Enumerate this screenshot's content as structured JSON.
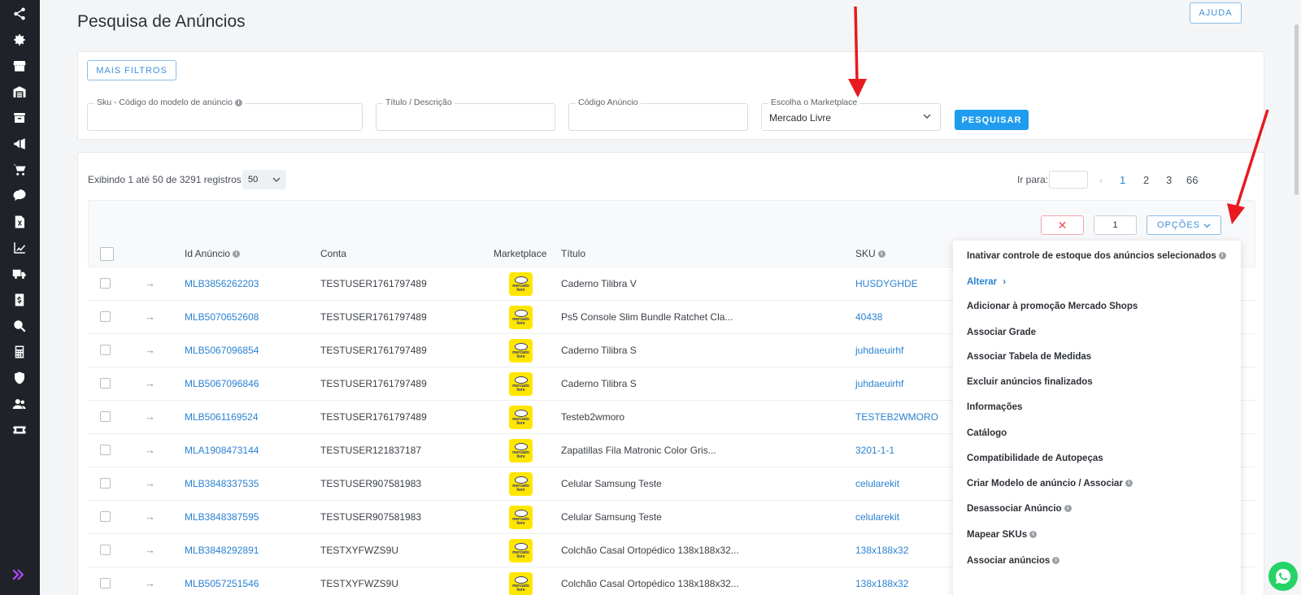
{
  "sidebar": {
    "icons": [
      "share-icon",
      "gear-icon",
      "store-icon",
      "warehouse-icon",
      "archive-icon",
      "megaphone-icon",
      "cart-icon",
      "chat-icon",
      "excel-icon",
      "chart-line-icon",
      "truck-icon",
      "invoice-icon",
      "search-dollar-icon",
      "calculator-icon",
      "shield-icon",
      "users-icon",
      "ticket-icon"
    ],
    "expand_icon": "double-chevron-right-icon"
  },
  "header": {
    "breadcrumb": "",
    "title": "Pesquisa de Anúncios",
    "help_label": "AJUDA"
  },
  "filters": {
    "more_filters_label": "MAIS FILTROS",
    "sku_label": "Sku - Código do modelo de anúncio",
    "sku_value": "",
    "title_label": "Título / Descrição",
    "title_value": "",
    "code_label": "Código Anúncio",
    "code_value": "",
    "marketplace_label": "Escolha o Marketplace",
    "marketplace_value": "Mercado Livre",
    "search_label": "PESQUISAR"
  },
  "results": {
    "showing_text": "Exibindo 1 até 50 de 3291 registros",
    "per_page": "50",
    "goto_label": "Ir para:",
    "goto_value": "",
    "pages": [
      "1",
      "2",
      "3",
      "66"
    ],
    "active_page": "1",
    "clear_icon": "close-icon",
    "selected_count": "1",
    "options_label": "OPÇÕES"
  },
  "table": {
    "headers": {
      "id": "Id Anúncio",
      "account": "Conta",
      "marketplace": "Marketplace",
      "title": "Título",
      "sku": "SKU"
    },
    "marketplace_logo_text": "mercado livre",
    "rows": [
      {
        "id": "MLB3856262203",
        "account": "TESTUSER1761797489",
        "title": "Caderno Tilibra V",
        "sku": "HUSDYGHDE"
      },
      {
        "id": "MLB5070652608",
        "account": "TESTUSER1761797489",
        "title": "Ps5 Console Slim Bundle Ratchet Cla...",
        "sku": "40438"
      },
      {
        "id": "MLB5067096854",
        "account": "TESTUSER1761797489",
        "title": "Caderno Tilibra S",
        "sku": "juhdaeuirhf"
      },
      {
        "id": "MLB5067096846",
        "account": "TESTUSER1761797489",
        "title": "Caderno Tilibra S",
        "sku": "juhdaeuirhf"
      },
      {
        "id": "MLB5061169524",
        "account": "TESTUSER1761797489",
        "title": "Testeb2wmoro",
        "sku": "TESTEB2WMORO"
      },
      {
        "id": "MLA1908473144",
        "account": "TESTUSER121837187",
        "title": "Zapatillas Fila Matronic Color Gris...",
        "sku": "3201-1-1"
      },
      {
        "id": "MLB3848337535",
        "account": "TESTUSER907581983",
        "title": "Celular Samsung Teste",
        "sku": "celularekit"
      },
      {
        "id": "MLB3848387595",
        "account": "TESTUSER907581983",
        "title": "Celular Samsung Teste",
        "sku": "celularekit"
      },
      {
        "id": "MLB3848292891",
        "account": "TESTXYFWZS9U",
        "title": "Colchão Casal Ortopédico 138x188x32...",
        "sku": "138x188x32"
      },
      {
        "id": "MLB5057251546",
        "account": "TESTXYFWZS9U",
        "title": "Colchão Casal Ortopédico 138x188x32...",
        "sku": "138x188x32"
      }
    ]
  },
  "options_menu": {
    "items": [
      "Inativar controle de estoque dos anúncios selecionados",
      "Alterar",
      "Adicionar à promoção Mercado Shops",
      "Associar Grade",
      "Associar Tabela de Medidas",
      "Excluir anúncios finalizados",
      "Informações",
      "Catálogo",
      "Compatibilidade de Autopeças",
      "Criar Modelo de anúncio / Associar",
      "Desassociar Anúncio",
      "Mapear SKUs",
      "Associar anúncios"
    ]
  },
  "colors": {
    "sidebar": "#1f2329",
    "accent": "#1f9cf0",
    "link": "#2a82d2",
    "annotation": "#e8191f",
    "marketplace_yellow": "#ffe600"
  },
  "whatsapp_icon": "whatsapp-icon"
}
